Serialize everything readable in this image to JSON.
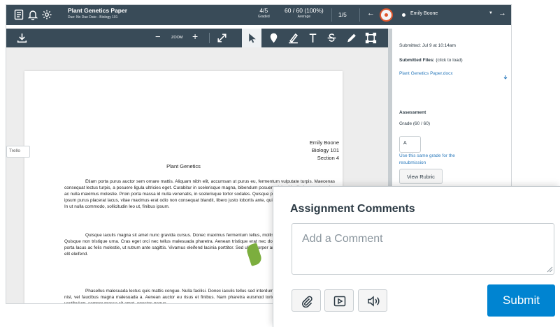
{
  "header": {
    "assignment_title": "Plant Genetics Paper",
    "assignment_subtitle": "Due: No Due Date - Biology 101",
    "graded_value": "4/5",
    "graded_label": "Graded",
    "average_value": "60 / 60 (100%)",
    "average_label": "Average",
    "pager": "1/5",
    "student_name": "Emily Boone",
    "icons": [
      "gradebook-icon",
      "bell-icon",
      "gear-icon",
      "arrow-left-icon",
      "dropdown-caret-icon",
      "arrow-right-icon"
    ]
  },
  "toolbar": {
    "zoom_label": "ZOOM",
    "zoom_minus": "−",
    "zoom_plus": "+",
    "tools": [
      "download-icon",
      "fullscreen-icon",
      "select-pointer-icon",
      "point-annotation-icon",
      "highlight-icon",
      "text-icon",
      "strikeout-icon",
      "free-draw-icon",
      "area-annotation-icon"
    ]
  },
  "document": {
    "student_name": "Emily Boone",
    "course": "Biology 101",
    "section": "Section 4",
    "title": "Plant Genetics",
    "paragraphs": [
      "Etiam porta purus auctor sem ornare mattis. Aliquam nibh elit, accumsan ut purus eu, fermentum vulputate turpis. Maecenas consequat lectus turpis, a posuere ligula ultricies eget. Curabitur in scelerisque magna, bibendum posuere dolor. Vestibulum eget sapien ac nulla maximus molestie. Proin porta massa id nulla venenatis, in scelerisque tortor sodales. Quisque pharetra, nisl ut cursus euismod, ipsum purus placerat lacus, vitae maximus erat odio non consequat blandit, libero justo lobortis ante, quis fringilla diam ligula sed tellus. In ut nulla commodo, sollicitudin leo ut, finibus ipsum.",
      "Quisque iaculis magna sit amet nunc gravida cursus. Donec maximus fermentum tellus, mollis auctor nisi consectetur mattis. Quisque non tristique urna. Cras eget orci nec tellus malesuada pharetra. Aenean tristique erat nec dolor malesuada convallis. Fusce porta lacus ac felis molestie, ut rutrum ante sagittis. Vivamus eleifend lacinia porttitor. Sed ullamcorper ante ac risus tempor, eu pulvinar elit eleifend.",
      "Phasellus malesuada lectus quis mattis congue. Nulla facilisi. Donec iaculis tellus sed interdum mattis. Sed malesuada aliquet nisl, vel faucibus magna malesuada a. Aenean auctor eu risus et finibus. Nam pharetra euismod tortor sit amet rutrum. Proin at ex vestibulum, semper massa sit amet, egestas neque."
    ],
    "trello_label": "Trello"
  },
  "sidebar": {
    "submitted": "Submitted: Jul 9 at 10:14am",
    "submitted_files_label": "Submitted Files:",
    "submitted_files_hint": "(click to load)",
    "file_name": "Plant Genetics Paper.docx",
    "assessment_label": "Assessment",
    "grade_label": "Grade (60 / 60)",
    "grade_value": "A",
    "resubmission_link_1": "Use this same grade for the",
    "resubmission_link_2": "resubmission",
    "view_rubric": "View Rubric"
  },
  "comments": {
    "title": "Assignment Comments",
    "placeholder": "Add a Comment",
    "attach_icon": "paperclip-icon",
    "media_icon": "media-play-icon",
    "audio_icon": "speaker-icon",
    "submit_label": "Submit"
  },
  "colors": {
    "header_bg": "#394b58",
    "submit_blue": "#0084d1",
    "link_blue": "#2b7abc",
    "avatar_ring": "#e0562c"
  }
}
